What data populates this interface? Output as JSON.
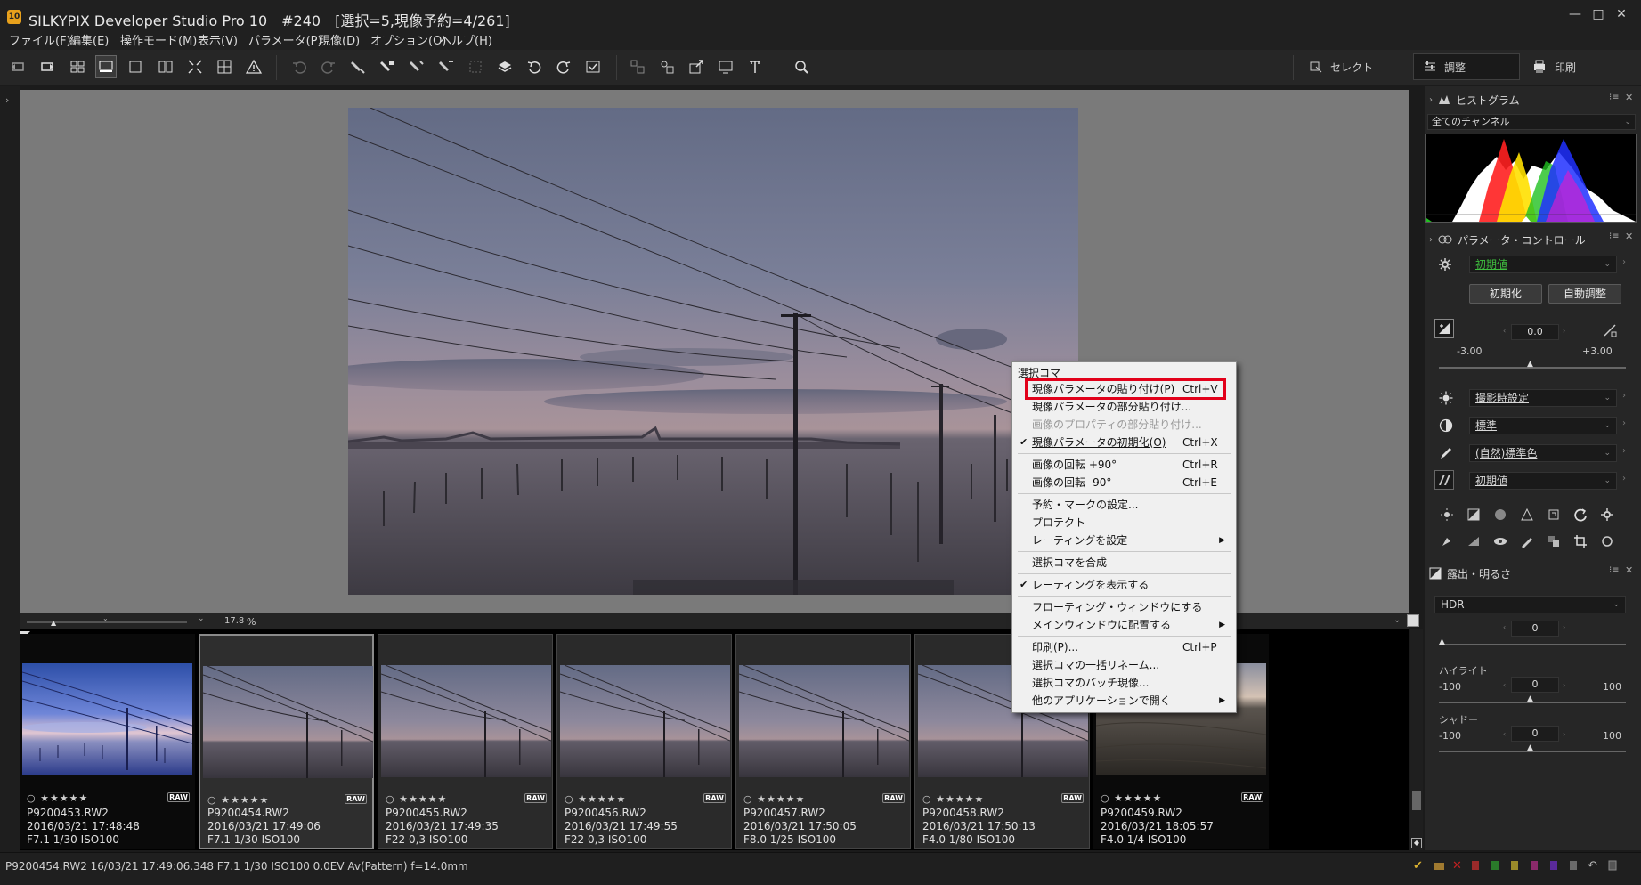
{
  "window": {
    "app_badge": "10",
    "title": "SILKYPIX Developer Studio Pro 10　#240　[選択=5,現像予約=4/261]",
    "controls": [
      "—",
      "□",
      "✕"
    ]
  },
  "menu": [
    "ファイル(F)",
    "編集(E)",
    "操作モード(M)",
    "表示(V)",
    "パラメータ(P)",
    "現像(D)",
    "オプション(O)",
    "ヘルプ(H)"
  ],
  "mode_tabs": {
    "select": "セレクト",
    "adjust": "調整",
    "print": "印刷"
  },
  "zoom": {
    "value": "17.8",
    "unit": "%"
  },
  "thumbnails": [
    {
      "file": "P9200453.RW2",
      "date": "2016/03/21 17:48:48",
      "exif": "F7.1 1/30 ISO100",
      "raw": "RAW",
      "stars": "○ ★★★★★"
    },
    {
      "file": "P9200454.RW2",
      "date": "2016/03/21 17:49:06",
      "exif": "F7.1 1/30 ISO100",
      "raw": "RAW",
      "stars": "○ ★★★★★"
    },
    {
      "file": "P9200455.RW2",
      "date": "2016/03/21 17:49:35",
      "exif": "F22 0,3 ISO100",
      "raw": "RAW",
      "stars": "○ ★★★★★"
    },
    {
      "file": "P9200456.RW2",
      "date": "2016/03/21 17:49:55",
      "exif": "F22 0,3 ISO100",
      "raw": "RAW",
      "stars": "○ ★★★★★"
    },
    {
      "file": "P9200457.RW2",
      "date": "2016/03/21 17:50:05",
      "exif": "F8.0 1/25 ISO100",
      "raw": "RAW",
      "stars": "○ ★★★★★"
    },
    {
      "file": "P9200458.RW2",
      "date": "2016/03/21 17:50:13",
      "exif": "F4.0 1/80 ISO100",
      "raw": "RAW",
      "stars": "○ ★★★★★"
    },
    {
      "file": "P9200459.RW2",
      "date": "2016/03/21 18:05:57",
      "exif": "F4.0 1/4 ISO100",
      "raw": "RAW",
      "stars": "○ ★★★★★"
    }
  ],
  "status": {
    "text": "P9200454.RW2 16/03/21 17:49:06.348 F7.1 1/30 ISO100  0.0EV Av(Pattern) f=14.0mm"
  },
  "right_panel": {
    "histogram": {
      "title": "ヒストグラム",
      "channel": "全てのチャンネル"
    },
    "param_control": {
      "title": "パラメータ・コントロール",
      "preset": "初期値",
      "init_button": "初期化",
      "auto_button": "自動調整",
      "exposure_value": "0.0",
      "exposure_min": "-3.00",
      "exposure_max": "+3.00",
      "white_balance": "撮影時設定",
      "tone": "標準",
      "color": "(自然)標準色",
      "sharpness": "初期値"
    },
    "exposure_brightness": {
      "title": "露出・明るさ",
      "mode": "HDR",
      "hdr_value": "0",
      "highlight_label": "ハイライト",
      "highlight_min": "-100",
      "highlight_value": "0",
      "highlight_max": "100",
      "shadow_label": "シャドー",
      "shadow_min": "-100",
      "shadow_value": "0",
      "shadow_max": "100"
    }
  },
  "context_menu": {
    "header": "選択コマ",
    "items": [
      {
        "label": "現像パラメータの貼り付け(P)",
        "shortcut": "Ctrl+V"
      },
      {
        "label": "現像パラメータの部分貼り付け..."
      },
      {
        "label": "画像のプロパティの部分貼り付け..."
      },
      {
        "label": "現像パラメータの初期化(O)",
        "shortcut": "Ctrl+X",
        "check": "✔"
      },
      {
        "label": "画像の回転 +90°",
        "shortcut": "Ctrl+R"
      },
      {
        "label": "画像の回転 -90°",
        "shortcut": "Ctrl+E"
      },
      {
        "label": "予約・マークの設定..."
      },
      {
        "label": "プロテクト"
      },
      {
        "label": "レーティングを設定",
        "submenu": "▶"
      },
      {
        "label": "選択コマを合成"
      },
      {
        "label": "レーティングを表示する",
        "check": "✔"
      },
      {
        "label": "フローティング・ウィンドウにする"
      },
      {
        "label": "メインウィンドウに配置する",
        "submenu": "▶"
      },
      {
        "label": "印刷(P)...",
        "shortcut": "Ctrl+P"
      },
      {
        "label": "選択コマの一括リネーム..."
      },
      {
        "label": "選択コマのバッチ現像..."
      },
      {
        "label": "他のアプリケーションで開く",
        "submenu": "▶"
      }
    ]
  },
  "colors": {
    "accent_highlight": "#e2001a",
    "preset_green": "#3fbf3f",
    "app_icon": "#e8a11c"
  }
}
